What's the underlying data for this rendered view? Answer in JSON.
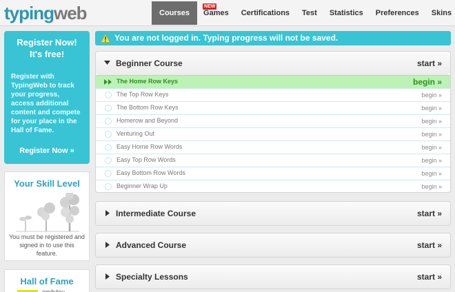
{
  "logo": {
    "part1": "typing",
    "part2": "web"
  },
  "nav": [
    {
      "label": "Courses",
      "active": true
    },
    {
      "label": "Games",
      "badge": "NEW"
    },
    {
      "label": "Certifications"
    },
    {
      "label": "Test"
    },
    {
      "label": "Statistics"
    },
    {
      "label": "Preferences"
    },
    {
      "label": "Skins"
    }
  ],
  "register": {
    "title": "Register Now!\nIt's free!",
    "title_line1": "Register Now!",
    "title_line2": "It's free!",
    "text": "Register with TypingWeb to track your progress, access additional content and compete for your place in the Hall of Fame.",
    "button": "Register Now »"
  },
  "skill": {
    "title": "Your Skill Level",
    "text": "You must be registered and signed in to use this feature."
  },
  "hall_of_fame": {
    "title": "Hall of Fame",
    "name": "emilylou"
  },
  "notice": {
    "text": "You are not logged in. Typing progress will not be saved."
  },
  "courses": {
    "beginner": {
      "title": "Beginner Course",
      "start": "start »",
      "lessons": [
        {
          "name": "The Home Row Keys",
          "action": "begin »",
          "current": true
        },
        {
          "name": "The Top Row Keys",
          "action": "begin »"
        },
        {
          "name": "The Bottom Row Keys",
          "action": "begin »"
        },
        {
          "name": "Homerow and Beyond",
          "action": "begin »"
        },
        {
          "name": "Venturing Out",
          "action": "begin »"
        },
        {
          "name": "Easy Home Row Words",
          "action": "begin »"
        },
        {
          "name": "Easy Top Row Words",
          "action": "begin »"
        },
        {
          "name": "Easy Bottom Row Words",
          "action": "begin »"
        },
        {
          "name": "Beginner Wrap Up",
          "action": "begin »"
        }
      ]
    },
    "intermediate": {
      "title": "Intermediate Course",
      "start": "start »"
    },
    "advanced": {
      "title": "Advanced Course",
      "start": "start »"
    },
    "specialty": {
      "title": "Specialty Lessons",
      "start": "start »"
    }
  },
  "colors": {
    "accent": "#38c4d4",
    "current_lesson_bg": "#bdf2b5",
    "current_lesson_text": "#2e8f22",
    "active_tab": "#6d6d6d"
  }
}
